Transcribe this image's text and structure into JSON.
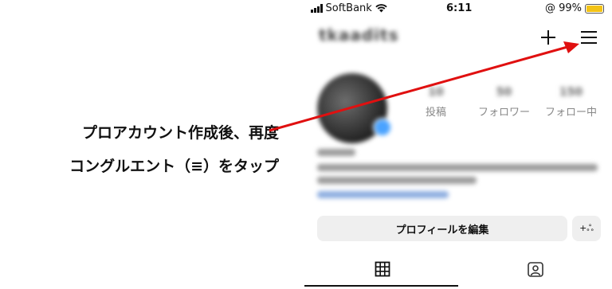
{
  "instruction": {
    "line1": "プロアカウント作成後、再度",
    "line2": "コングルエント（≡）をタップ"
  },
  "status_bar": {
    "carrier": "SoftBank",
    "time": "6:11",
    "battery": "@ 99%"
  },
  "profile": {
    "username": "tkaadits",
    "stats": [
      {
        "value": "10",
        "label": "投稿"
      },
      {
        "value": "50",
        "label": "フォロワー"
      },
      {
        "value": "150",
        "label": "フォロー中"
      }
    ],
    "edit_profile_label": "プロフィールを編集",
    "add_person_label": "+ஃ"
  },
  "icons": {
    "plus": "plus-icon",
    "menu": "hamburger-menu-icon",
    "grid": "grid-icon",
    "tagged": "tagged-person-icon",
    "wifi": "wifi-icon",
    "signal": "signal-icon",
    "battery": "battery-icon"
  },
  "colors": {
    "arrow": "#e01010",
    "battery": "#f3c316",
    "button_bg": "#efefef"
  }
}
